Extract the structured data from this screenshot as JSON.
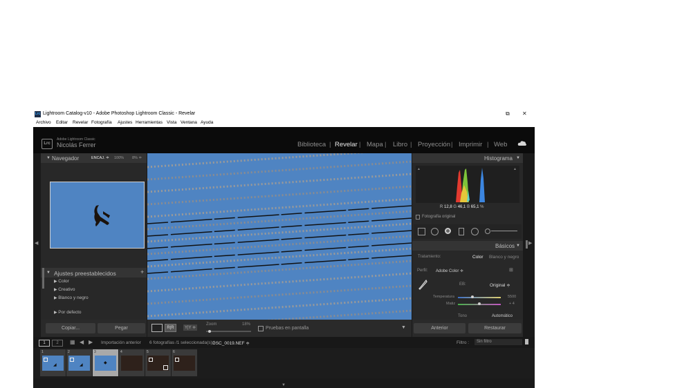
{
  "window": {
    "title": "Lightroom Catalog-v10 - Adobe Photoshop Lightroom Classic - Revelar",
    "app_badge": "Lrc",
    "restore_glyph": "⧉",
    "close_glyph": "✕"
  },
  "menu": [
    "Archivo",
    "Editar",
    "Revelar",
    "Fotografía",
    "Ajustes",
    "Herramientas",
    "Vista",
    "Ventana",
    "Ayuda"
  ],
  "identity": {
    "product": "Adobe Lightroom Classic",
    "user": "Nicolás Ferrer",
    "logo": "Lrc"
  },
  "modules": [
    "Biblioteca",
    "Revelar",
    "Mapa",
    "Libro",
    "Proyección",
    "Imprimir",
    "Web"
  ],
  "active_module": "Revelar",
  "left_panel": {
    "navigator": {
      "title": "Navegador",
      "zoom_fit": "ENCAJ. ≑",
      "zoom_100": "100%",
      "zoom_pct": "8% ≑"
    },
    "presets": {
      "title": "Ajustes preestablecidos",
      "add": "+",
      "items": [
        "Color",
        "Creativo",
        "Blanco y negro",
        "Por defecto"
      ]
    },
    "copy_button": "Copiar...",
    "paste_button": "Pegar"
  },
  "right_panel": {
    "histogram": {
      "title": "Histograma",
      "r_label": "R",
      "r_value": "12,8",
      "g_label": "G",
      "g_value": "46,1",
      "b_label": "B",
      "b_value": "65,1",
      "pct": "%",
      "original_photo": "Fotografía original"
    },
    "basics": {
      "title": "Básicos",
      "treatment_label": "Tratamiento:",
      "treatment_color": "Color",
      "treatment_bw": "Blanco y negro",
      "profile_label": "Perfil:",
      "profile_value": "Adobe Color ≑",
      "wb_label": "EB:",
      "wb_value": "Original ≑",
      "temp_label": "Temperatura",
      "temp_value": "5500",
      "tint_label": "Matiz",
      "tint_value": "+ 4",
      "tone_label": "Tono",
      "auto_label": "Automático"
    },
    "previous_button": "Anterior",
    "reset_button": "Restaurar"
  },
  "toolbar": {
    "yy_label": "Y|Y ≑",
    "zoom_label": "Zoom",
    "zoom_value": "18%",
    "soft_proof": "Pruebas en pantalla"
  },
  "filmstrip_bar": {
    "page1": "1",
    "page2": "2",
    "source": "Importación anterior",
    "info_prefix": "6 fotografías /1 seleccionada(s) /",
    "filename": "DSC_0019.NEF ≑",
    "filter_label": "Filtro :",
    "filter_value": "Sin filtro"
  },
  "thumbnails": [
    {
      "number": "1",
      "kind": "sky"
    },
    {
      "number": "2",
      "kind": "sky"
    },
    {
      "number": "3",
      "kind": "sky"
    },
    {
      "number": "4",
      "kind": "dark"
    },
    {
      "number": "5",
      "kind": "dark"
    },
    {
      "number": "6",
      "kind": "dark"
    }
  ],
  "colors": {
    "sky": "#4f84c2",
    "dark_thumb": "#3a2a22",
    "panel": "#282828",
    "header": "#343434"
  }
}
